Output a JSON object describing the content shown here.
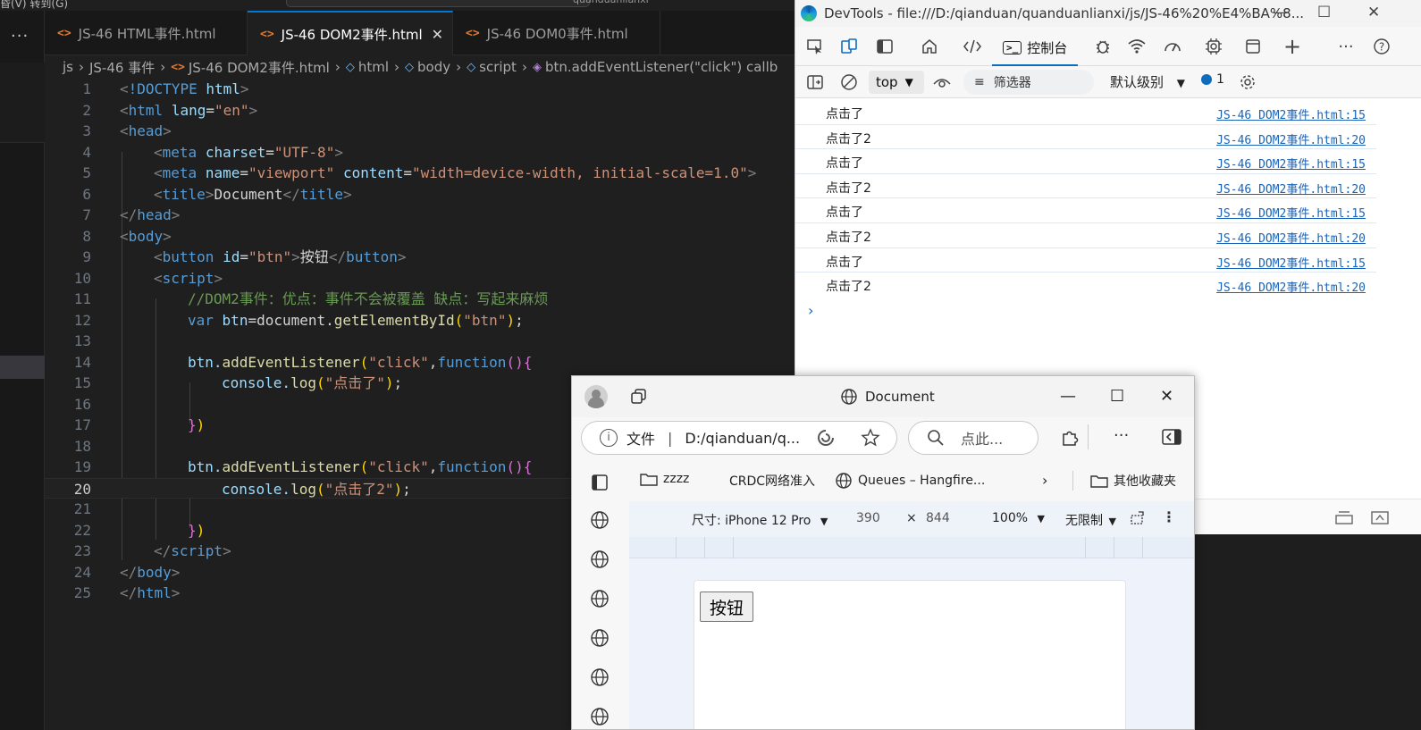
{
  "vscode": {
    "titlebar": {
      "menu_text": "昏(V)    转到(G)",
      "search_text": "quanduanlianxi"
    },
    "more_label": "···",
    "tabs": [
      {
        "label": "JS-46 HTML事件.html",
        "icon": "html-file-icon"
      },
      {
        "label": "JS-46 DOM2事件.html",
        "icon": "html-file-icon",
        "close": "✕"
      },
      {
        "label": "JS-46 DOM0事件.html",
        "icon": "html-file-icon"
      }
    ],
    "breadcrumb": {
      "folder": "js",
      "subfolder": "JS-46 事件",
      "file": "JS-46 DOM2事件.html",
      "node1": "html",
      "node2": "body",
      "node3": "script",
      "node4": "btn.addEventListener(\"click\") callb"
    },
    "code_lines": [
      {
        "n": "1"
      },
      {
        "n": "2"
      },
      {
        "n": "3"
      },
      {
        "n": "4"
      },
      {
        "n": "5"
      },
      {
        "n": "6"
      },
      {
        "n": "7"
      },
      {
        "n": "8"
      },
      {
        "n": "9"
      },
      {
        "n": "10"
      },
      {
        "n": "11"
      },
      {
        "n": "12"
      },
      {
        "n": "13"
      },
      {
        "n": "14"
      },
      {
        "n": "15"
      },
      {
        "n": "16"
      },
      {
        "n": "17"
      },
      {
        "n": "18"
      },
      {
        "n": "19"
      },
      {
        "n": "20"
      },
      {
        "n": "21"
      },
      {
        "n": "22"
      },
      {
        "n": "23"
      },
      {
        "n": "24"
      },
      {
        "n": "25"
      }
    ],
    "code": {
      "doctype_kw": "!DOCTYPE",
      "doctype_val": "html",
      "html": "html",
      "lang": "lang",
      "lang_val": "\"en\"",
      "head": "head",
      "meta": "meta",
      "charset": "charset",
      "charset_val": "\"UTF-8\"",
      "name": "name",
      "name_val": "\"viewport\"",
      "content": "content",
      "content_val": "\"width=device-width, initial-scale=1.0\"",
      "title": "title",
      "title_text": "Document",
      "body": "body",
      "button": "button",
      "id": "id",
      "id_val": "\"btn\"",
      "button_text": "按钮",
      "script": "script",
      "comment": "//DOM2事件：优点：事件不会被覆盖 缺点：写起来麻烦",
      "var": "var",
      "btn": "btn",
      "eq_doc": "=document.",
      "getById": "getElementById",
      "str_btn": "\"btn\"",
      "btn_dot": "btn.",
      "addListener": "addEventListener",
      "str_click": "\"click\"",
      "function_kw": "function",
      "console_log": "console.",
      "log": "log",
      "str_msg1": "\"点击了\"",
      "str_msg2": "\"点击了2\""
    }
  },
  "devtools": {
    "title": "DevTools - file:///D:/qianduan/quanduanlianxi/js/JS-46%20%E4%BA%8...",
    "console_tab": "控制台",
    "context": "top",
    "filter_placeholder": "筛选器",
    "level": "默认级别",
    "issues_count": "1",
    "logs": [
      {
        "msg": "点击了",
        "src": "JS-46 DOM2事件.html:15"
      },
      {
        "msg": "点击了2",
        "src": "JS-46 DOM2事件.html:20"
      },
      {
        "msg": "点击了",
        "src": "JS-46 DOM2事件.html:15"
      },
      {
        "msg": "点击了2",
        "src": "JS-46 DOM2事件.html:20"
      },
      {
        "msg": "点击了",
        "src": "JS-46 DOM2事件.html:15"
      },
      {
        "msg": "点击了2",
        "src": "JS-46 DOM2事件.html:20"
      },
      {
        "msg": "点击了",
        "src": "JS-46 DOM2事件.html:15"
      },
      {
        "msg": "点击了2",
        "src": "JS-46 DOM2事件.html:20"
      }
    ],
    "prompt": "›"
  },
  "edge": {
    "title": "Document",
    "url_scheme": "文件",
    "url": "D:/qianduan/q...",
    "search_placeholder": "点此...",
    "favorites": [
      {
        "label": "zzzz"
      },
      {
        "label": "CRDC网络准入"
      },
      {
        "label": "Queues – Hangfire..."
      },
      {
        "label": "其他收藏夹"
      }
    ],
    "device": {
      "size_label": "尺寸: iPhone 12 Pro",
      "width": "390",
      "times": "×",
      "height": "844",
      "zoom": "100%",
      "throttle": "无限制"
    },
    "page_button": "按钮"
  },
  "colors": {
    "editor_bg": "#1f1f1f",
    "accent": "#0078d4",
    "link": "#1a63b7",
    "keyword": "#569cd6",
    "string": "#ce9178",
    "comment": "#6a9955"
  }
}
